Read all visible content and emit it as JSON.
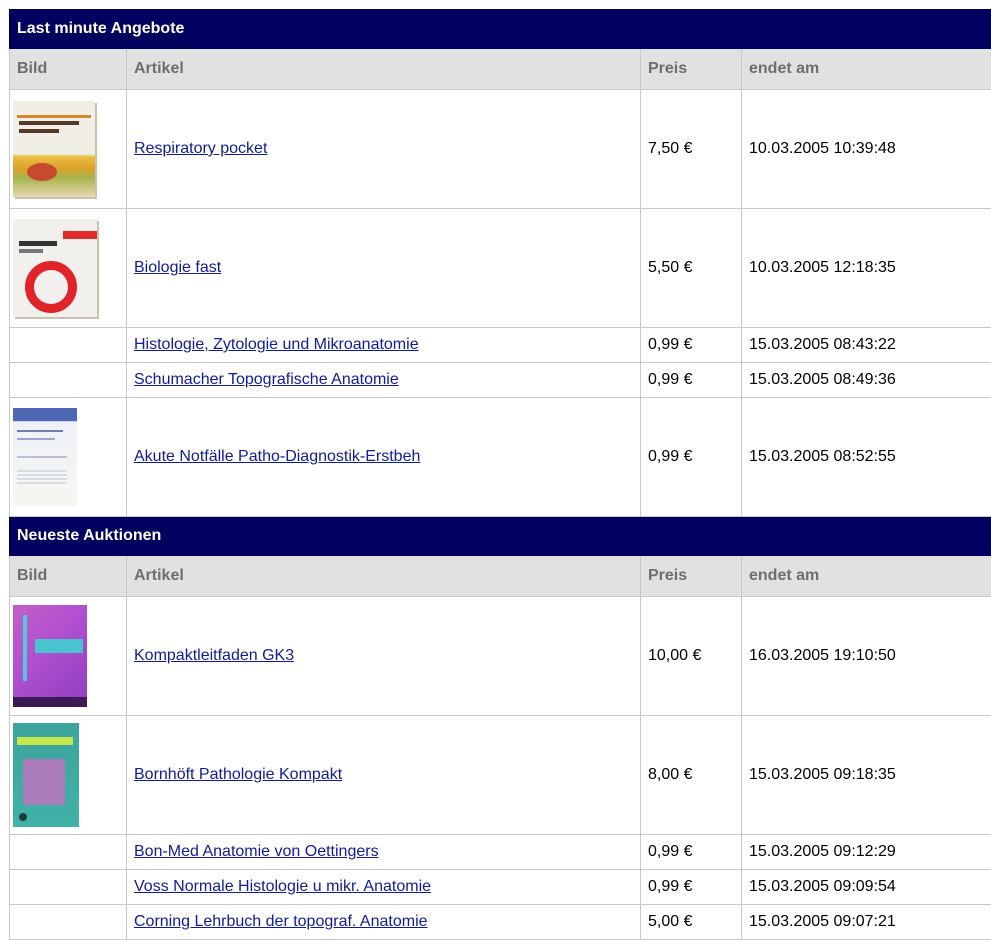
{
  "sections": [
    {
      "title": "Last minute Angebote",
      "headers": {
        "image": "Bild",
        "article": "Artikel",
        "price": "Preis",
        "ends": "endet am"
      },
      "rows": [
        {
          "article": "Respiratory pocket",
          "price": "7,50 €",
          "ends": "10.03.2005 10:39:48",
          "image": "cover-respiratory-pocket"
        },
        {
          "article": "Biologie fast",
          "price": "5,50 €",
          "ends": "10.03.2005 12:18:35",
          "image": "cover-biologie-fast"
        },
        {
          "article": "Histologie, Zytologie und Mikroanatomie",
          "price": "0,99 €",
          "ends": "15.03.2005 08:43:22",
          "image": ""
        },
        {
          "article": "Schumacher Topografische Anatomie",
          "price": "0,99 €",
          "ends": "15.03.2005 08:49:36",
          "image": ""
        },
        {
          "article": "Akute Notfälle Patho-Diagnostik-Erstbeh",
          "price": "0,99 €",
          "ends": "15.03.2005 08:52:55",
          "image": "cover-akute-notfaelle"
        }
      ]
    },
    {
      "title": "Neueste Auktionen",
      "headers": {
        "image": "Bild",
        "article": "Artikel",
        "price": "Preis",
        "ends": "endet am"
      },
      "rows": [
        {
          "article": "Kompaktleitfaden GK3",
          "price": "10,00 €",
          "ends": "16.03.2005 19:10:50",
          "image": "cover-kompaktleitfaden"
        },
        {
          "article": "Bornhöft Pathologie Kompakt",
          "price": "8,00 €",
          "ends": "15.03.2005 09:18:35",
          "image": "cover-pathologie-kompakt"
        },
        {
          "article": "Bon-Med Anatomie von Oettingers",
          "price": "0,99 €",
          "ends": "15.03.2005 09:12:29",
          "image": ""
        },
        {
          "article": "Voss Normale Histologie u mikr. Anatomie",
          "price": "0,99 €",
          "ends": "15.03.2005 09:09:54",
          "image": ""
        },
        {
          "article": "Corning Lehrbuch der topograf. Anatomie",
          "price": "5,00 €",
          "ends": "15.03.2005 09:07:21",
          "image": ""
        }
      ]
    }
  ],
  "colors": {
    "section_header_bg": "#00005e",
    "column_header_bg": "#e1e1e1",
    "column_header_text": "#6e6e6e",
    "link": "#0f1c9b",
    "grid": "#c8c8c8"
  }
}
